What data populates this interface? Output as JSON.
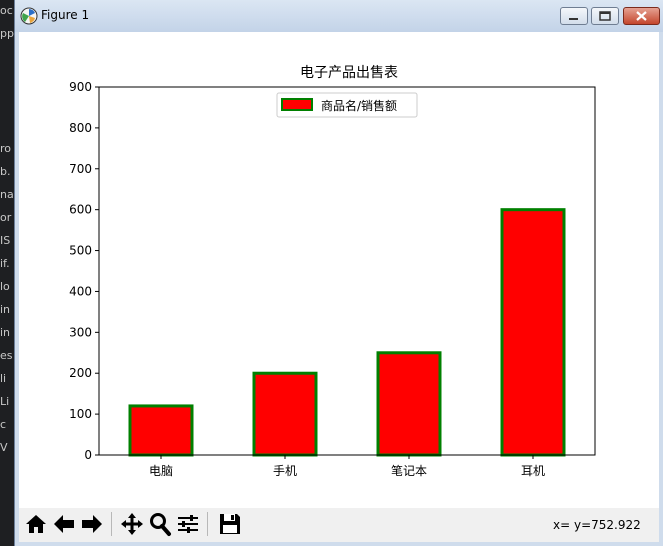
{
  "window": {
    "title": "Figure 1"
  },
  "background_strip": {
    "fragments": [
      "oc",
      "pp",
      "",
      "",
      "",
      "",
      "ro",
      "b.",
      "na",
      "or",
      "IS",
      "if.",
      "lo",
      "in",
      "in",
      "es",
      "li",
      "Li",
      "c",
      "V"
    ]
  },
  "toolbar": {
    "buttons": [
      "home",
      "back",
      "forward",
      "pan",
      "zoom",
      "configure-subplots",
      "save"
    ],
    "coordinates_readout": "x= y=752.922"
  },
  "chart_data": {
    "type": "bar",
    "title": "电子产品出售表",
    "categories": [
      "电脑",
      "手机",
      "笔记本",
      "耳机"
    ],
    "series": [
      {
        "name": "商品名/销售额",
        "values": [
          120,
          200,
          250,
          600
        ]
      }
    ],
    "ylim": [
      0,
      900
    ],
    "yticks": [
      0,
      100,
      200,
      300,
      400,
      500,
      600,
      700,
      800,
      900
    ],
    "bar_color": "#ff0000",
    "edge_color": "#008000",
    "grid": false,
    "legend_position": "upper center"
  }
}
